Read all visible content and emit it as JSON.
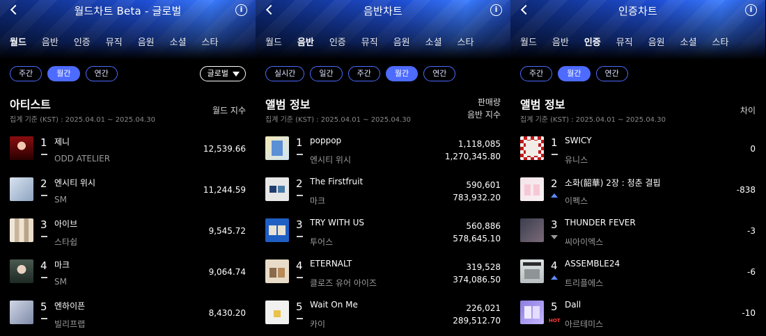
{
  "panels": [
    {
      "title": "월드차트 Beta - 글로벌",
      "tabs": [
        "월드",
        "음반",
        "인증",
        "뮤직",
        "음원",
        "소셜",
        "스타"
      ],
      "active_tab": 0,
      "chips": [
        "주간",
        "월간",
        "연간"
      ],
      "active_chip": 1,
      "dropdown": "글로벌",
      "section_title": "아티스트",
      "section_sub": "집계 기준 (KST) : 2025.04.01 ~ 2025.04.30",
      "column_head": "월드 지수",
      "rows": [
        {
          "rank": "1",
          "name": "제니",
          "sub": "ODD ATELIER",
          "value": "12,539.66",
          "trend": "same",
          "thumb": "jennie-thumb"
        },
        {
          "rank": "2",
          "name": "엔시티 위시",
          "sub": "SM",
          "value": "11,244.59",
          "trend": "same",
          "thumb": "nct-wish-thumb"
        },
        {
          "rank": "3",
          "name": "아이브",
          "sub": "스타쉽",
          "value": "9,545.72",
          "trend": "same",
          "thumb": "ive-thumb"
        },
        {
          "rank": "4",
          "name": "마크",
          "sub": "SM",
          "value": "9,064.74",
          "trend": "same",
          "thumb": "mark-thumb"
        },
        {
          "rank": "5",
          "name": "엔하이픈",
          "sub": "빌리프랩",
          "value": "8,430.20",
          "trend": "same",
          "thumb": "enhypen-thumb"
        }
      ]
    },
    {
      "title": "음반차트",
      "tabs": [
        "월드",
        "음반",
        "인증",
        "뮤직",
        "음원",
        "소셜",
        "스타"
      ],
      "active_tab": 1,
      "chips": [
        "실시간",
        "일간",
        "주간",
        "월간",
        "연간"
      ],
      "active_chip": 3,
      "section_title": "앨범 정보",
      "section_sub": "집계 기준 (KST) : 2025.04.01 ~ 2025.04.30",
      "column_head_1": "판매량",
      "column_head_2": "음반 지수",
      "rows": [
        {
          "rank": "1",
          "name": "poppop",
          "sub": "엔시티 위시",
          "value1": "1,118,085",
          "value2": "1,270,345.80",
          "trend": "same",
          "thumb": "poppop-thumb"
        },
        {
          "rank": "2",
          "name": "The Firstfruit",
          "sub": "마크",
          "value1": "590,601",
          "value2": "783,932.20",
          "trend": "same",
          "thumb": "firstfruit-thumb"
        },
        {
          "rank": "3",
          "name": "TRY WITH US",
          "sub": "투어스",
          "value1": "560,886",
          "value2": "578,645.10",
          "trend": "same",
          "thumb": "try-with-us-thumb"
        },
        {
          "rank": "4",
          "name": "ETERNALT",
          "sub": "클로즈 유어 아이즈",
          "value1": "319,528",
          "value2": "374,086.50",
          "trend": "same",
          "thumb": "eternalt-thumb"
        },
        {
          "rank": "5",
          "name": "Wait On Me",
          "sub": "카이",
          "value1": "226,021",
          "value2": "289,512.70",
          "trend": "same",
          "thumb": "wait-on-me-thumb"
        }
      ]
    },
    {
      "title": "인증차트",
      "tabs": [
        "월드",
        "음반",
        "인증",
        "뮤직",
        "음원",
        "소셜",
        "스타"
      ],
      "active_tab": 2,
      "chips": [
        "주간",
        "월간",
        "연간"
      ],
      "active_chip": 1,
      "section_title": "앨범 정보",
      "section_sub": "집계 기준 (KST) : 2025.04.01 ~ 2025.04.30",
      "column_head": "차이",
      "rows": [
        {
          "rank": "1",
          "name": "SWICY",
          "sub": "유니스",
          "value": "0",
          "trend": "same",
          "thumb": "swicy-thumb"
        },
        {
          "rank": "2",
          "name": "소화(韶華) 2장 : 청춘 결핍",
          "sub": "이펙스",
          "value": "-838",
          "trend": "up",
          "thumb": "sohwa-thumb"
        },
        {
          "rank": "3",
          "name": "THUNDER FEVER",
          "sub": "씨아이엑스",
          "value": "-3",
          "trend": "down",
          "thumb": "thunder-fever-thumb"
        },
        {
          "rank": "4",
          "name": "ASSEMBLE24",
          "sub": "트리플에스",
          "value": "-6",
          "trend": "up",
          "thumb": "assemble24-thumb"
        },
        {
          "rank": "5",
          "name": "Dall",
          "sub": "아르테미스",
          "value": "-10",
          "trend": "hot",
          "hot_label": "HOT",
          "thumb": "dall-thumb"
        }
      ]
    }
  ],
  "colors": {
    "accent": "#4d6bff",
    "up": "#5c8cff",
    "hot": "#ff3b3b"
  }
}
